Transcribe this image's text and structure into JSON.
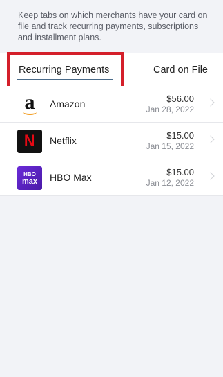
{
  "intro": {
    "text": "Keep tabs on which merchants have your card on file and track recurring payments, subscriptions and installment plans."
  },
  "tabs": [
    {
      "label": "Recurring Payments",
      "selected": true
    },
    {
      "label": "Card on File",
      "selected": false
    }
  ],
  "merchants": [
    {
      "name": "Amazon",
      "amount": "$56.00",
      "date": "Jan 28, 2022",
      "logo_text": "a",
      "icon": "amazon-logo"
    },
    {
      "name": "Netflix",
      "amount": "$15.00",
      "date": "Jan 15, 2022",
      "logo_text": "N",
      "icon": "netflix-logo"
    },
    {
      "name": "HBO Max",
      "amount": "$15.00",
      "date": "Jan 12, 2022",
      "logo_text": "HBO max",
      "icon": "hbo-max-logo"
    }
  ],
  "colors": {
    "highlight": "#d41f2a",
    "tab_underline": "#4a6b8a",
    "netflix_red": "#e50914",
    "hbo_purple": "#5a22c0"
  }
}
